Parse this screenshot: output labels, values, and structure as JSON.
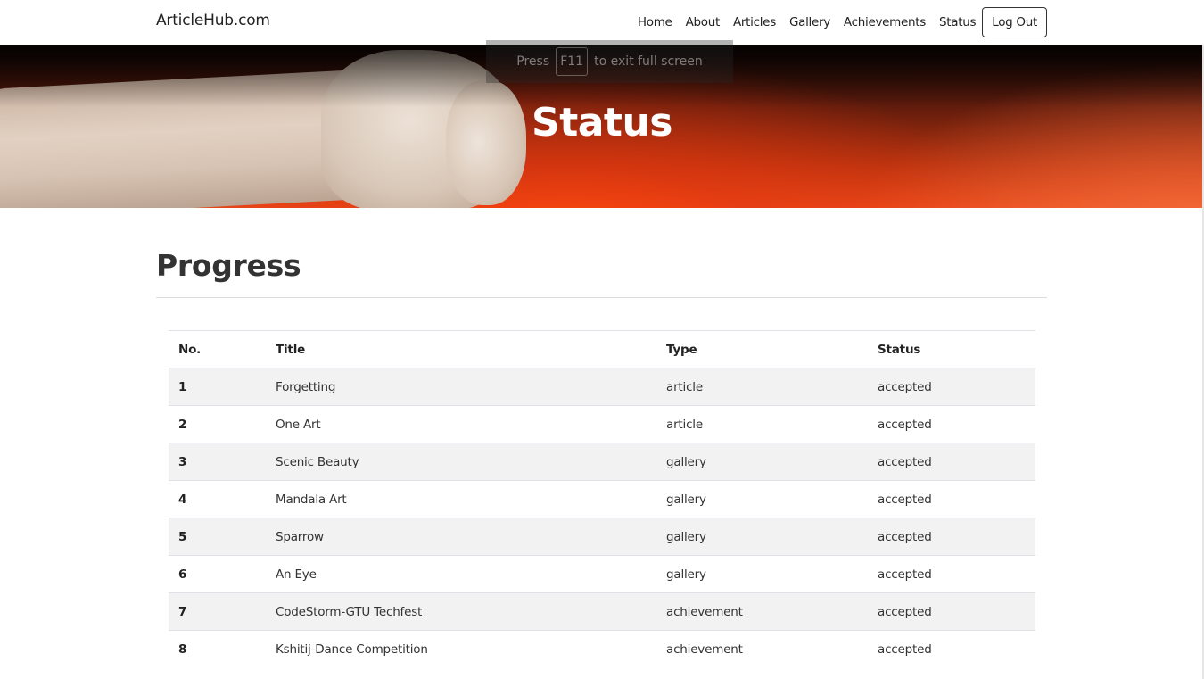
{
  "navbar": {
    "brand": "ArticleHub.com",
    "links": [
      "Home",
      "About",
      "Articles",
      "Gallery",
      "Achievements",
      "Status"
    ],
    "logout_label": "Log Out"
  },
  "fullscreen_hint": {
    "prefix": "Press",
    "key": "F11",
    "suffix": "to exit full screen"
  },
  "hero": {
    "title": "Status"
  },
  "main": {
    "heading": "Progress",
    "table": {
      "headers": [
        "No.",
        "Title",
        "Type",
        "Status"
      ],
      "rows": [
        [
          "1",
          "Forgetting",
          "article",
          "accepted"
        ],
        [
          "2",
          "One Art",
          "article",
          "accepted"
        ],
        [
          "3",
          "Scenic Beauty",
          "gallery",
          "accepted"
        ],
        [
          "4",
          "Mandala Art",
          "gallery",
          "accepted"
        ],
        [
          "5",
          "Sparrow",
          "gallery",
          "accepted"
        ],
        [
          "6",
          "An Eye",
          "gallery",
          "accepted"
        ],
        [
          "7",
          "CodeStorm-GTU Techfest",
          "achievement",
          "accepted"
        ],
        [
          "8",
          "Kshitij-Dance Competition",
          "achievement",
          "accepted"
        ]
      ]
    }
  },
  "colors": {
    "hero_accent": "#e8491a",
    "stripe": "#f2f2f2",
    "divider": "#dddddd"
  }
}
